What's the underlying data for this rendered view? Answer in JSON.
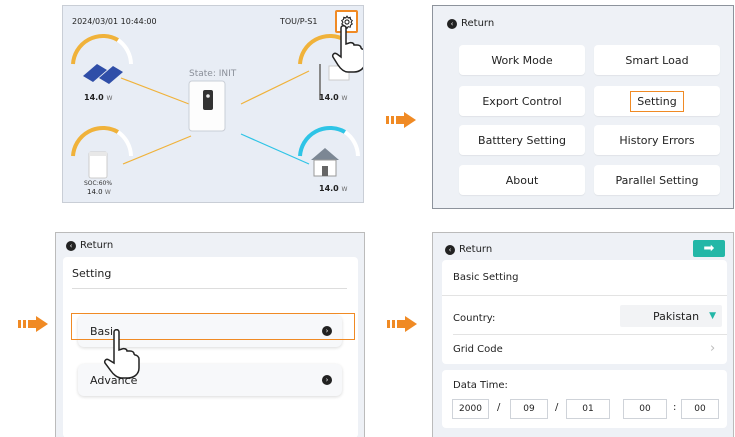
{
  "panel1": {
    "datetime": "2024/03/01 10:44:00",
    "tou": "TOU/P-S1",
    "state": "State: INIT",
    "pv": {
      "value": "14.0",
      "unit": "W"
    },
    "load": {
      "value": "14.0",
      "unit": "W"
    },
    "battery": {
      "soc": "SOC:60%",
      "value": "14.0",
      "unit": "W"
    },
    "grid": {
      "value": "14.0",
      "unit": "W"
    }
  },
  "panel2": {
    "return": "Return",
    "buttons": [
      "Work Mode",
      "Smart Load",
      "Export Control",
      "Setting",
      "Batttery Setting",
      "History Errors",
      "About",
      "Parallel Setting"
    ]
  },
  "panel3": {
    "return": "Return",
    "title": "Setting",
    "items": [
      "Basic",
      "Advance"
    ]
  },
  "panel4": {
    "return": "Return",
    "title": "Basic Setting",
    "country_label": "Country:",
    "country_value": "Pakistan",
    "grid_code": "Grid Code",
    "data_time_label": "Data Time:",
    "year": "2000",
    "month": "09",
    "day": "01",
    "hour": "00",
    "minute": "00",
    "date_sep": "/",
    "time_sep": ":"
  },
  "colors": {
    "accent": "#f08a24",
    "teal": "#23b7a7",
    "cyan": "#2ec4e6"
  }
}
